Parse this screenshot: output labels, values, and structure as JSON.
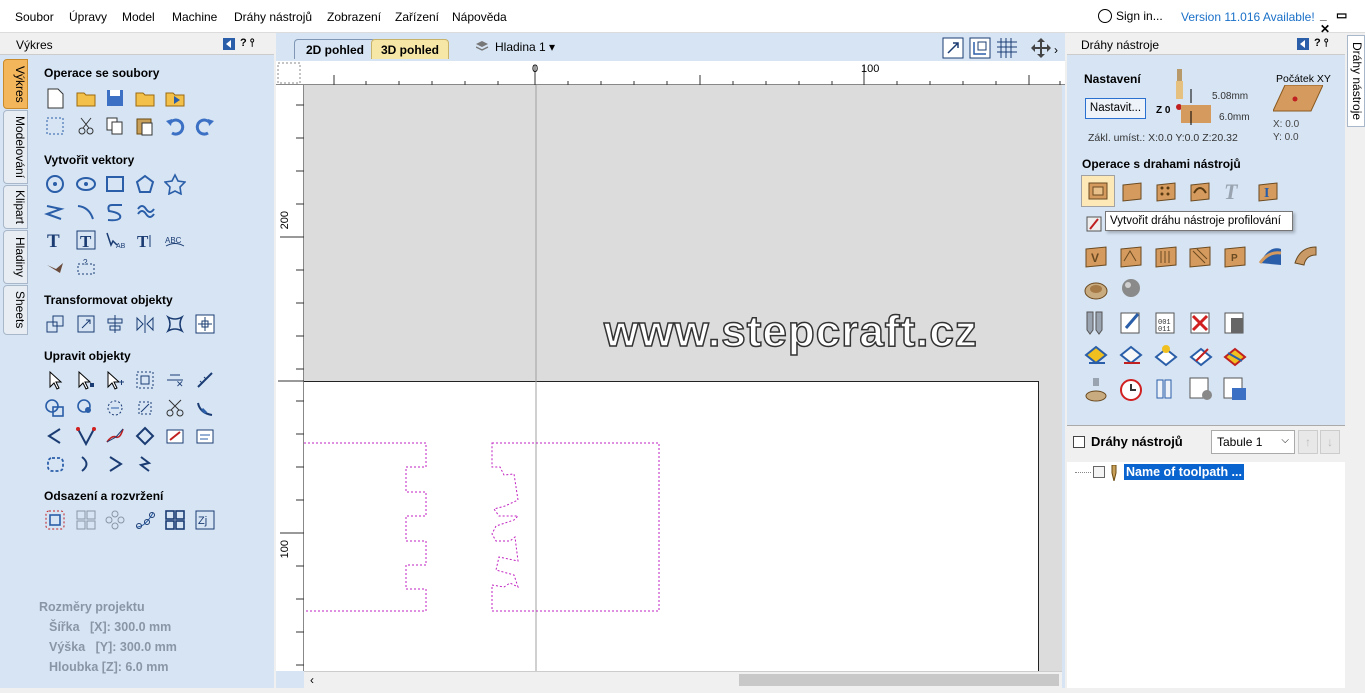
{
  "menu": [
    "Soubor",
    "Úpravy",
    "Model",
    "Machine",
    "Dráhy nástrojů",
    "Zobrazení",
    "Zařízení",
    "Nápověda"
  ],
  "account": {
    "signin": "Sign in...",
    "version": "Version 11.016 Available!",
    "window_controls": "_ ▭ ✕"
  },
  "left_panel": {
    "title": "Výkres",
    "pin": "? ⫯",
    "tabs": [
      "Výkres",
      "Modelování",
      "Klipart",
      "Hladiny",
      "Sheets"
    ],
    "sections": {
      "file_ops": "Operace se soubory",
      "create_vectors": "Vytvořit vektory",
      "transform": "Transformovat objekty",
      "edit": "Upravit objekty",
      "offset": "Odsazení a rozvržení"
    },
    "project": {
      "title": "Rozměry projektu",
      "width": "Šířka   [X]: 300.0 mm",
      "height": "Výška   [Y]: 300.0 mm",
      "depth": "Hloubka [Z]: 6.0 mm"
    }
  },
  "view": {
    "tab_2d": "2D pohled",
    "tab_3d": "3D pohled",
    "layer": "Hladina 1",
    "ruler_top": [
      "0",
      "100"
    ],
    "ruler_left": [
      "200",
      "100"
    ],
    "watermark": "www.stepcraft.cz"
  },
  "right_panel": {
    "title": "Dráhy nástroje",
    "side_tab": "Dráhy nástroje",
    "settings": {
      "label": "Nastavení",
      "button": "Nastavit...",
      "z_label": "Z 0",
      "dim1": "5.08mm",
      "dim2": "6.0mm",
      "home": "Zákl. umíst.: X:0.0 Y:0.0 Z:20.32",
      "origin_label": "Počátek XY",
      "origin_x": "X: 0.0",
      "origin_y": "Y: 0.0"
    },
    "ops_title": "Operace s drahami nástrojů",
    "tooltip": "Vytvořit dráhu nástroje profilování",
    "list_title": "Dráhy nástrojů",
    "sheet_select": "Tabule 1",
    "toolpath_item": "Name of toolpath ..."
  },
  "colors": {
    "panel": "#d6e4f4",
    "accent_tab": "#f4b65b",
    "tab_3d": "#f7e7a6",
    "link": "#1a70c8",
    "vector_dashed": "#c020c0"
  }
}
